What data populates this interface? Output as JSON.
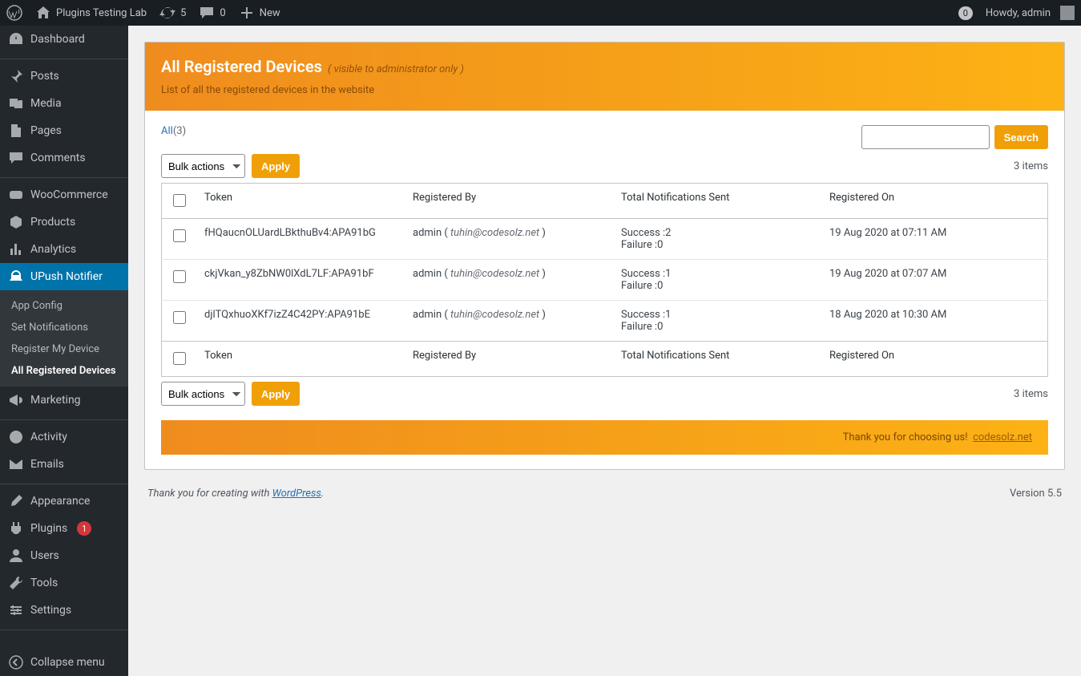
{
  "adminbar": {
    "site_name": "Plugins Testing Lab",
    "updates": "5",
    "comments": "0",
    "new": "New",
    "notif_count": "0",
    "howdy": "Howdy, admin"
  },
  "menu": {
    "dashboard": "Dashboard",
    "posts": "Posts",
    "media": "Media",
    "pages": "Pages",
    "comments": "Comments",
    "woocommerce": "WooCommerce",
    "products": "Products",
    "analytics": "Analytics",
    "upush": "UPush Notifier",
    "sub": {
      "app_config": "App Config",
      "set_notifications": "Set Notifications",
      "register_device": "Register My Device",
      "all_devices": "All Registered Devices"
    },
    "marketing": "Marketing",
    "activity": "Activity",
    "emails": "Emails",
    "appearance": "Appearance",
    "plugins": "Plugins",
    "plugins_count": "1",
    "users": "Users",
    "tools": "Tools",
    "settings": "Settings",
    "collapse": "Collapse menu"
  },
  "header": {
    "title": "All Registered Devices",
    "visible": "( visible to administrator only )",
    "desc": "List of all the registered devices in the website"
  },
  "filter": {
    "all_label": "All",
    "all_count": "(3)"
  },
  "bulk": {
    "placeholder": "Bulk actions",
    "apply": "Apply"
  },
  "search": {
    "button": "Search"
  },
  "items_count": "3 items",
  "table": {
    "columns": {
      "token": "Token",
      "registered_by": "Registered By",
      "total_sent": "Total Notifications Sent",
      "registered_on": "Registered On"
    },
    "rows": [
      {
        "token": "fHQaucnOLUardLBkthuBv4:APA91bG",
        "by_user": "admin",
        "by_email": "tuhin@codesolz.net",
        "success": "Success :2",
        "failure": "Failure :0",
        "on": "19 Aug 2020 at 07:11 AM"
      },
      {
        "token": "ckjVkan_y8ZbNW0lXdL7LF:APA91bF",
        "by_user": "admin",
        "by_email": "tuhin@codesolz.net",
        "success": "Success :1",
        "failure": "Failure :0",
        "on": "19 Aug 2020 at 07:07 AM"
      },
      {
        "token": "djlTQxhuoXKf7izZ4C42PY:APA91bE",
        "by_user": "admin",
        "by_email": "tuhin@codesolz.net",
        "success": "Success :1",
        "failure": "Failure :0",
        "on": "18 Aug 2020 at 10:30 AM"
      }
    ]
  },
  "thanks": {
    "text": "Thank you for choosing us!",
    "link": "codesolz.net"
  },
  "wpfooter": {
    "thankyou": "Thank you for creating with ",
    "wp": "WordPress",
    "version": "Version 5.5"
  }
}
